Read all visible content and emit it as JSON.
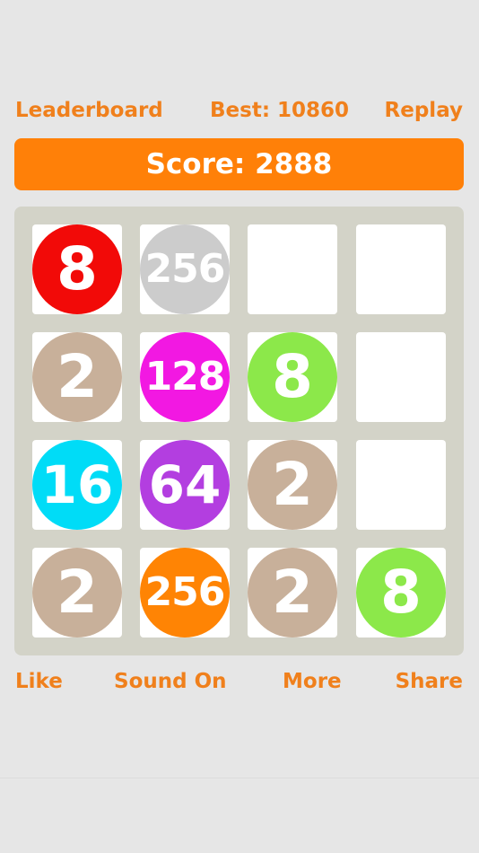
{
  "header": {
    "leaderboard_label": "Leaderboard",
    "best_text": "Best: 10860",
    "replay_label": "Replay"
  },
  "score": {
    "text": "Score: 2888"
  },
  "board": {
    "rows": [
      [
        8,
        256,
        null,
        null
      ],
      [
        2,
        128,
        8,
        null
      ],
      [
        16,
        64,
        2,
        null
      ],
      [
        2,
        256,
        2,
        8
      ]
    ],
    "tile_colors": {
      "2": "#c8b09a",
      "8": "#8ce84a",
      "16": "#00dcf7",
      "64": "#b33ee0",
      "128": "#f218e2",
      "256_red": "#f20a08",
      "256_orange": "#ff8404"
    },
    "color_overrides": [
      [
        "#f20a08",
        null,
        null,
        null
      ],
      [
        null,
        null,
        null,
        null
      ],
      [
        null,
        null,
        null,
        null
      ],
      [
        null,
        "#ff8404",
        null,
        null
      ]
    ]
  },
  "footer": {
    "like_label": "Like",
    "sound_label": "Sound On",
    "more_label": "More",
    "share_label": "Share"
  },
  "colors": {
    "accent": "#f0801c",
    "score_bar": "#ff8008",
    "board_bg": "#d3d3c8",
    "cell_bg": "#ffffff",
    "page_bg": "#e6e6e6"
  }
}
